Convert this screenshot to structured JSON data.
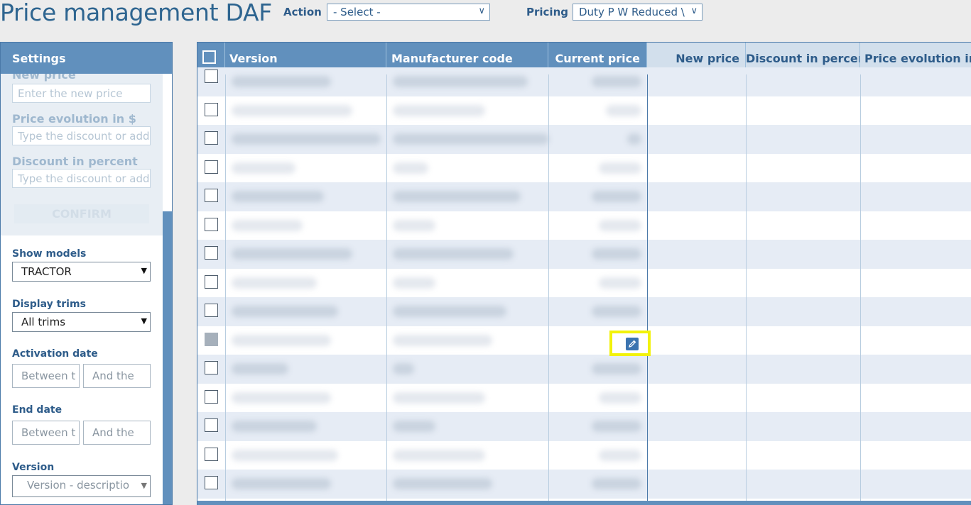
{
  "header": {
    "title": "Price management DAF",
    "action_label": "Action",
    "action_value": "- Select -",
    "pricing_label": "Pricing",
    "pricing_value": "Duty P W Reduced \\"
  },
  "sidebar": {
    "title": "Settings",
    "faded": {
      "new_price_label": "New price",
      "new_price_placeholder": "Enter the new price",
      "price_evolution_label": "Price evolution in $",
      "price_evolution_placeholder": "Type the discount or addi",
      "discount_label": "Discount in percent",
      "discount_placeholder": "Type the discount or addi",
      "confirm_label": "CONFIRM"
    },
    "show_models_label": "Show models",
    "show_models_value": "TRACTOR",
    "display_trims_label": "Display trims",
    "display_trims_value": "All trims",
    "activation_date_label": "Activation date",
    "activation_between": "Between t",
    "activation_and": "And the",
    "end_date_label": "End date",
    "end_between": "Between t",
    "end_and": "And the",
    "version_label": "Version",
    "version_placeholder": "Version - descriptio"
  },
  "grid": {
    "columns": {
      "version": "Version",
      "manufacturer_code": "Manufacturer code",
      "current_price": "Current price",
      "new_price": "New price",
      "discount_percent": "Discount in percent",
      "price_evolution": "Price evolution in $"
    },
    "selected_row_index": 9
  },
  "colors": {
    "header_dark": "#6190bd",
    "header_light": "#d2dfec",
    "row_alt": "#e6ecf5",
    "highlight": "#f2f20a"
  }
}
